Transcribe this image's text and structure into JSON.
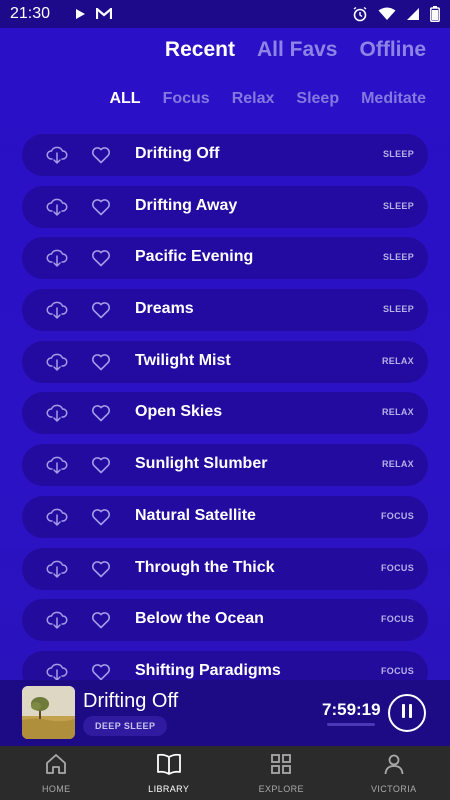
{
  "status_bar": {
    "time": "21:30"
  },
  "top_tabs": [
    {
      "label": "Recent",
      "active": true
    },
    {
      "label": "All Favs",
      "active": false
    },
    {
      "label": "Offline",
      "active": false
    }
  ],
  "category_tabs": [
    {
      "label": "ALL",
      "active": true
    },
    {
      "label": "Focus",
      "active": false
    },
    {
      "label": "Relax",
      "active": false
    },
    {
      "label": "Sleep",
      "active": false
    },
    {
      "label": "Meditate",
      "active": false
    }
  ],
  "tracks": [
    {
      "title": "Drifting Off",
      "tag": "SLEEP"
    },
    {
      "title": "Drifting Away",
      "tag": "SLEEP"
    },
    {
      "title": "Pacific Evening",
      "tag": "SLEEP"
    },
    {
      "title": "Dreams",
      "tag": "SLEEP"
    },
    {
      "title": "Twilight Mist",
      "tag": "RELAX"
    },
    {
      "title": "Open Skies",
      "tag": "RELAX"
    },
    {
      "title": "Sunlight Slumber",
      "tag": "RELAX"
    },
    {
      "title": "Natural Satellite",
      "tag": "FOCUS"
    },
    {
      "title": "Through the Thick",
      "tag": "FOCUS"
    },
    {
      "title": "Below the Ocean",
      "tag": "FOCUS"
    },
    {
      "title": "Shifting Paradigms",
      "tag": "FOCUS"
    }
  ],
  "now_playing": {
    "title": "Drifting Off",
    "badge": "DEEP SLEEP",
    "time_remaining": "7:59:19",
    "progress": 0.0
  },
  "bottom_nav": [
    {
      "label": "HOME",
      "icon": "home-icon",
      "active": false
    },
    {
      "label": "LIBRARY",
      "icon": "book-icon",
      "active": true
    },
    {
      "label": "EXPLORE",
      "icon": "grid-icon",
      "active": false
    },
    {
      "label": "VICTORIA",
      "icon": "person-icon",
      "active": false
    }
  ],
  "colors": {
    "background": "#2a10c6",
    "row_background": "#1e0682",
    "player_background": "#1d0b86",
    "nav_background": "#2b2b2b",
    "inactive_tab": "#8d84e6"
  }
}
